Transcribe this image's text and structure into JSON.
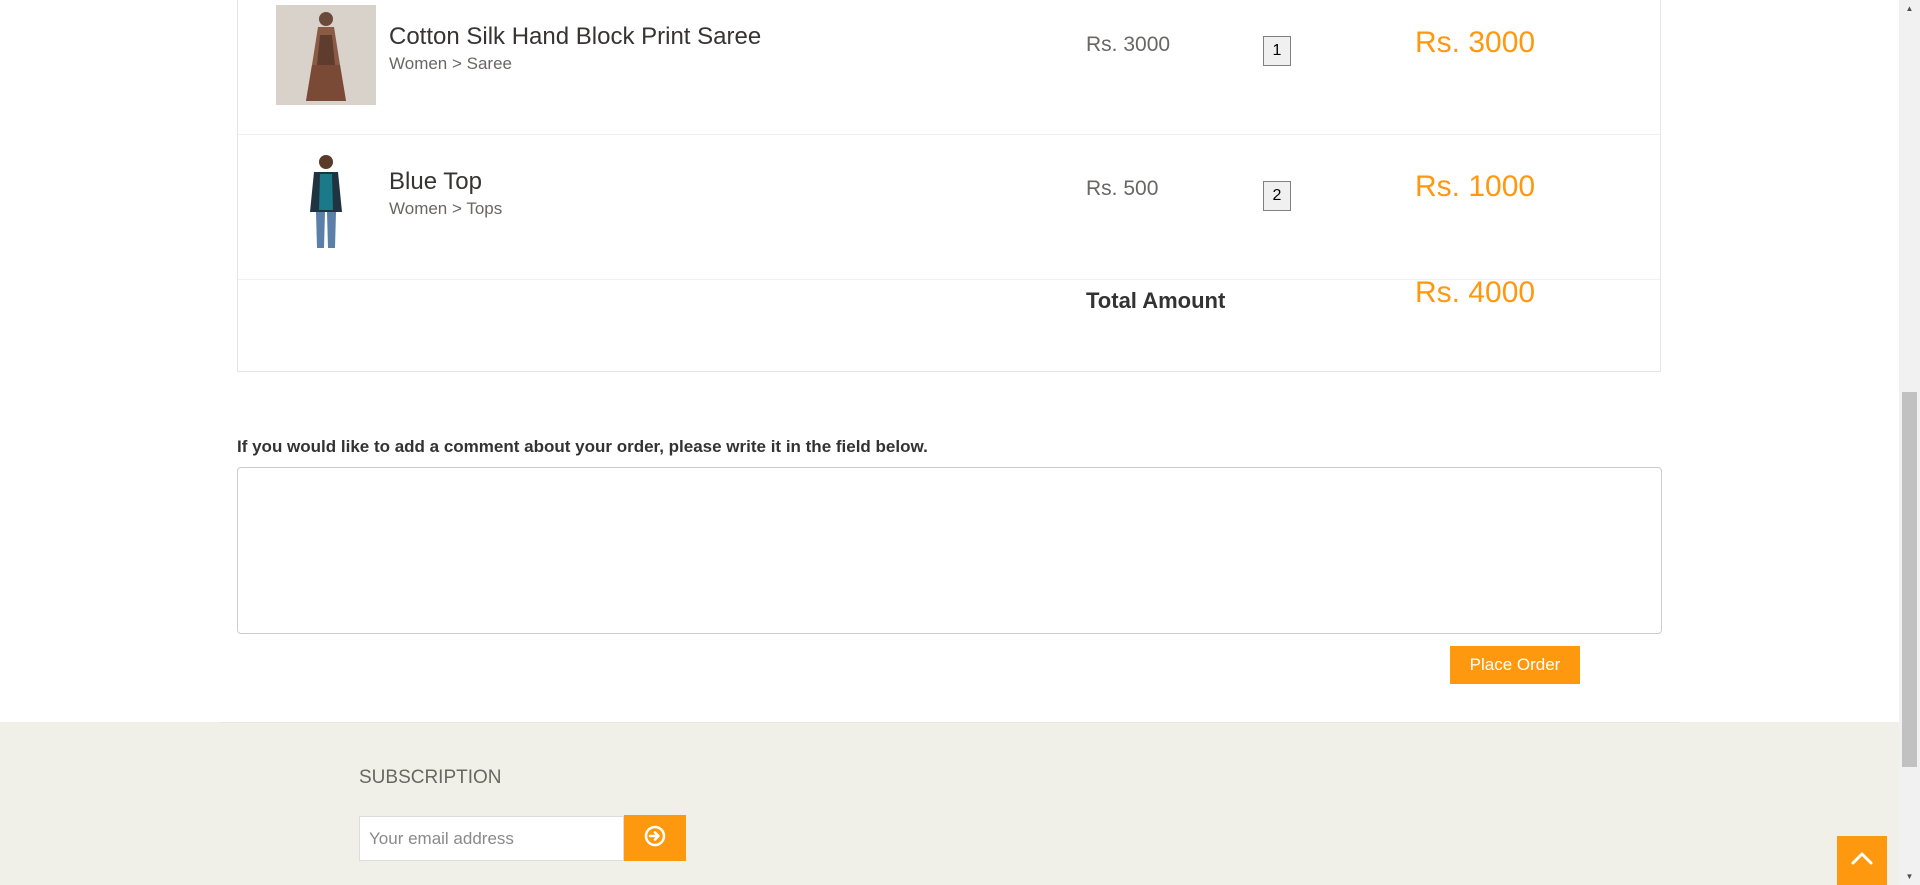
{
  "cart": {
    "items": [
      {
        "name": "Cotton Silk Hand Block Print Saree",
        "category": "Women > Saree",
        "price": "Rs. 3000",
        "quantity": "1",
        "total": "Rs. 3000"
      },
      {
        "name": "Blue Top",
        "category": "Women > Tops",
        "price": "Rs. 500",
        "quantity": "2",
        "total": "Rs. 1000"
      }
    ],
    "total_label": "Total Amount",
    "total_amount": "Rs. 4000"
  },
  "comment": {
    "label": "If you would like to add a comment about your order, please write it in the field below.",
    "value": ""
  },
  "place_order_label": "Place Order",
  "footer": {
    "subscription_title": "SUBSCRIPTION",
    "email_placeholder": "Your email address"
  },
  "colors": {
    "accent": "#fe980f",
    "footer_bg": "#f0f0e9"
  },
  "icons": {
    "subscribe": "arrow-circle-right-icon",
    "scroll_top": "chevron-up-icon"
  }
}
